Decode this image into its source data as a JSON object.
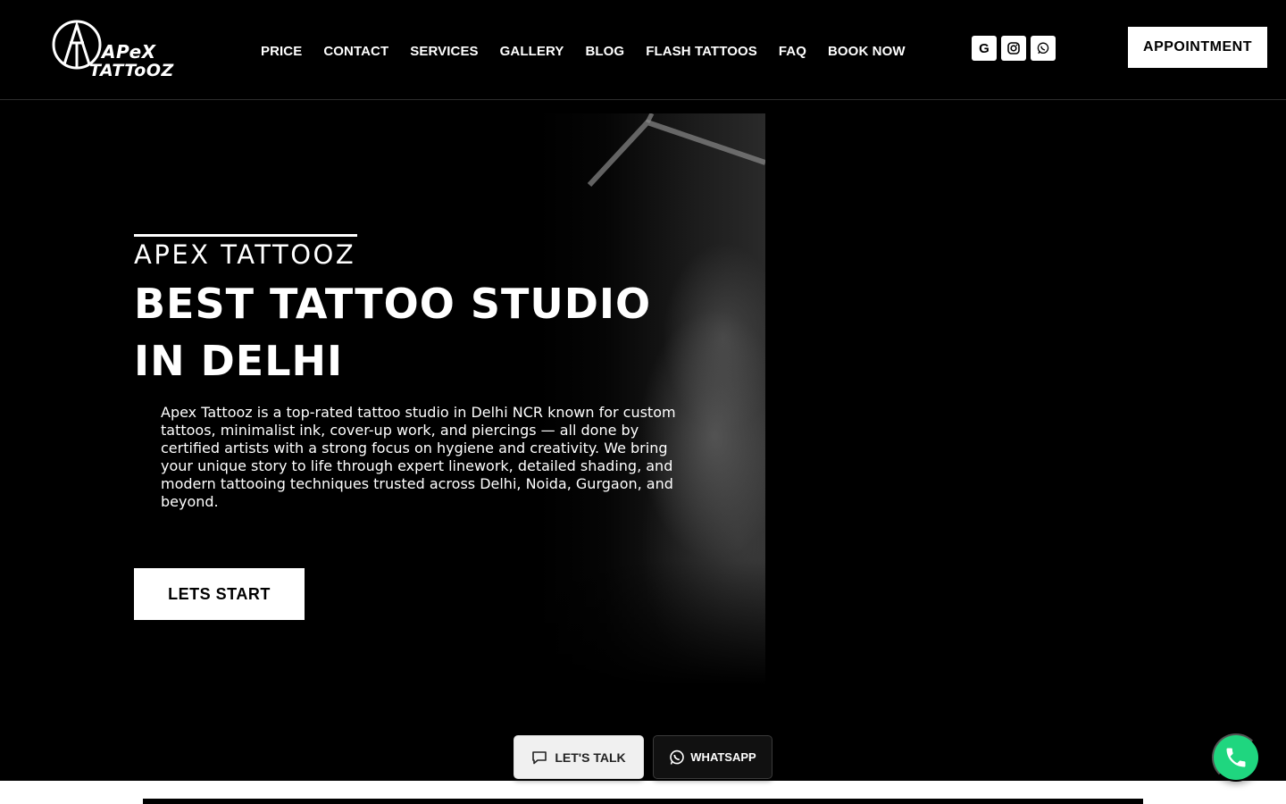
{
  "header": {
    "logo": {
      "line1": "APeX",
      "line2": "TATToOZ",
      "icon": "apex-triangle-logo-icon"
    },
    "nav": [
      {
        "label": "PRICE"
      },
      {
        "label": "CONTACT"
      },
      {
        "label": "SERVICES"
      },
      {
        "label": "GALLERY"
      },
      {
        "label": "BLOG"
      },
      {
        "label": "FLASH TATTOOS"
      },
      {
        "label": "FAQ"
      },
      {
        "label": "BOOK NOW"
      }
    ],
    "socials": [
      {
        "icon": "google-icon",
        "glyph": "G"
      },
      {
        "icon": "instagram-icon"
      },
      {
        "icon": "whatsapp-icon"
      }
    ],
    "appointment_label": "APPOINTMENT"
  },
  "hero": {
    "eyebrow": "APEX TATTOOZ",
    "title": "BEST TATTOO STUDIO IN DELHI",
    "description": "Apex Tattooz is a top-rated tattoo studio in Delhi NCR known for custom tattoos, minimalist ink, cover-up work, and piercings — all done by certified artists with a strong focus on hygiene and creativity. We bring your unique story to life through expert linework, detailed shading, and modern tattooing techniques trusted across Delhi, Noida, Gurgaon, and beyond.",
    "cta_label": "LETS START"
  },
  "floating": {
    "talk_label": "LET'S TALK",
    "whatsapp_label": "WHATSAPP",
    "call_icon": "phone-icon",
    "accent": "#1fd67f"
  }
}
